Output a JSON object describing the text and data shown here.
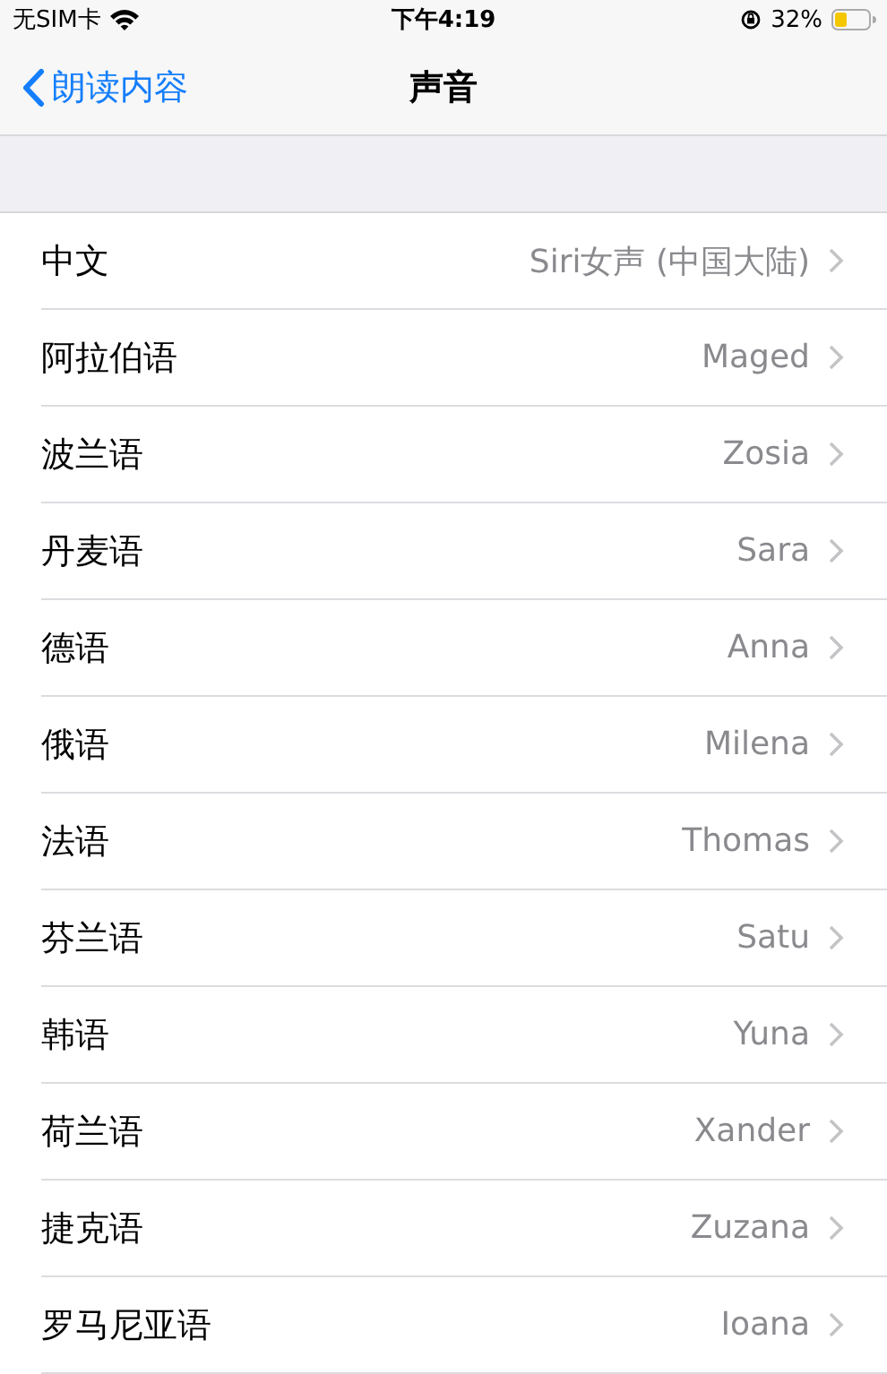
{
  "status_bar": {
    "carrier": "无SIM卡",
    "time": "下午4:19",
    "battery": "32%"
  },
  "nav": {
    "back": "朗读内容",
    "title": "声音"
  },
  "rows": [
    {
      "label": "中文",
      "value": "Siri女声 (中国大陆)"
    },
    {
      "label": "阿拉伯语",
      "value": "Maged"
    },
    {
      "label": "波兰语",
      "value": "Zosia"
    },
    {
      "label": "丹麦语",
      "value": "Sara"
    },
    {
      "label": "德语",
      "value": "Anna"
    },
    {
      "label": "俄语",
      "value": "Milena"
    },
    {
      "label": "法语",
      "value": "Thomas"
    },
    {
      "label": "芬兰语",
      "value": "Satu"
    },
    {
      "label": "韩语",
      "value": "Yuna"
    },
    {
      "label": "荷兰语",
      "value": "Xander"
    },
    {
      "label": "捷克语",
      "value": "Zuzana"
    },
    {
      "label": "罗马尼亚语",
      "value": "Ioana"
    }
  ]
}
